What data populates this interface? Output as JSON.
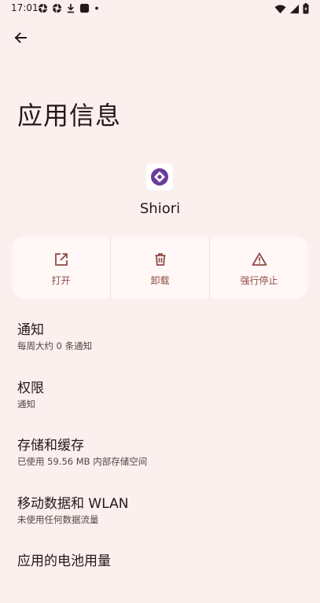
{
  "status_bar": {
    "time": "17:01",
    "left_icons": [
      "aperture-icon",
      "aperture-icon",
      "download-icon",
      "app-square-icon",
      "dot-icon"
    ],
    "right_icons": [
      "wifi-icon",
      "signal-icon",
      "battery-icon"
    ]
  },
  "header": {
    "back_icon": "arrow-left-icon",
    "title": "应用信息"
  },
  "app": {
    "name": "Shiori",
    "icon": "diamond-logo-icon",
    "icon_color": "#6a3d9a"
  },
  "actions": [
    {
      "label": "打开",
      "icon": "open-external-icon"
    },
    {
      "label": "卸载",
      "icon": "trash-icon"
    },
    {
      "label": "强行停止",
      "icon": "warning-icon"
    }
  ],
  "settings": [
    {
      "title": "通知",
      "subtitle": "每周大约 0 条通知"
    },
    {
      "title": "权限",
      "subtitle": "通知"
    },
    {
      "title": "存储和缓存",
      "subtitle": "已使用 59.56 MB 内部存储空间"
    },
    {
      "title": "移动数据和 WLAN",
      "subtitle": "未使用任何数据流量"
    },
    {
      "title": "应用的电池用量",
      "subtitle": ""
    }
  ],
  "colors": {
    "background": "#fcf0ef",
    "card": "#fff8f7",
    "accent": "#904a45",
    "text": "#231918"
  }
}
